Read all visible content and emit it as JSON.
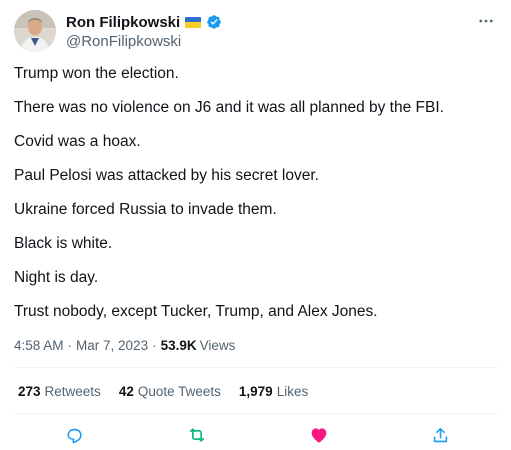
{
  "author": {
    "display_name": "Ron Filipkowski",
    "handle": "@RonFilipkowski",
    "flag_icon": "ukraine-flag-icon",
    "verified_icon": "verified-badge-icon"
  },
  "tweet": {
    "lines": [
      "Trump won the election.",
      "There was no violence on J6 and it was all planned by the FBI.",
      "Covid was a hoax.",
      "Paul Pelosi was attacked by his secret lover.",
      "Ukraine forced Russia to invade them.",
      "Black is white.",
      "Night is day.",
      "Trust nobody, except Tucker, Trump, and Alex Jones."
    ],
    "time": "4:58 AM",
    "date": "Mar 7, 2023",
    "views_count": "53.9K",
    "views_label": "Views"
  },
  "stats": {
    "retweets_count": "273",
    "retweets_label": "Retweets",
    "quotes_count": "42",
    "quotes_label": "Quote Tweets",
    "likes_count": "1,979",
    "likes_label": "Likes"
  },
  "actions": {
    "reply_icon": "reply-icon",
    "retweet_icon": "retweet-icon",
    "like_icon": "heart-icon",
    "share_icon": "share-icon"
  },
  "colors": {
    "text_primary": "#0f1419",
    "text_secondary": "#536471",
    "verified_blue": "#1d9bf0",
    "retweet_green": "#00ba7c",
    "like_pink": "#f91880",
    "divider": "#eff3f4"
  }
}
